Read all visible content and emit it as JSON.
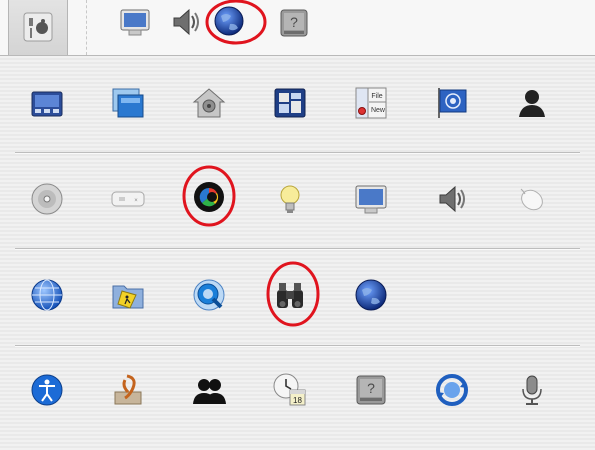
{
  "toolbar": {
    "items": [
      {
        "icon": "show-all-icon"
      },
      {
        "icon": "displays-icon"
      },
      {
        "icon": "sound-icon"
      },
      {
        "icon": "network-icon"
      },
      {
        "icon": "startup-disk-icon"
      }
    ]
  },
  "rows": [
    [
      "expose-spaces-icon",
      "desktop-screensaver-icon",
      "security-house-icon",
      "dashboard-widgets-icon",
      "general-appearance-icon",
      "international-flag-icon",
      "accounts-user-icon"
    ],
    [
      "cds-dvds-icon",
      "keyboard-icon",
      "colorsync-icon",
      "energy-saver-icon",
      "displays-icon",
      "sound-icon",
      "mouse-icon"
    ],
    [
      "network-globe-icon",
      "sharing-folder-icon",
      "quicktime-icon",
      "spotlight-binoculars-icon",
      "network-earth-icon"
    ],
    [
      "universal-access-icon",
      "speech-icon",
      "accounts-silhouette-icon",
      "date-time-icon",
      "startup-disk-icon",
      "software-update-icon",
      "microphone-icon"
    ]
  ],
  "general_file_text": "File",
  "general_new_text": "New",
  "date_time_day": "18",
  "colors": {
    "annotation_red": "#e0141e",
    "globe_blue": "#1f4fb0"
  }
}
